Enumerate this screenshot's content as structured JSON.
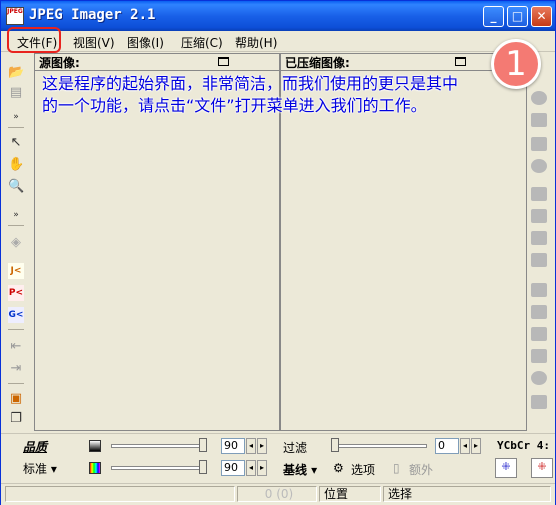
{
  "window": {
    "title": "JPEG Imager 2.1",
    "icon_label": "JPEG",
    "minimize_glyph": "_",
    "maximize_glyph": "□",
    "close_glyph": "✕"
  },
  "menu": [
    "文件(F)",
    "视图(V)",
    "图像(I)",
    "压缩(C)",
    "帮助(H)"
  ],
  "panels": {
    "source_title": "源图像:",
    "compressed_title": "已压缩图像:"
  },
  "instruction": "这是程序的起始界面，非常简洁，而我们使用的更只是其中的一个功能，请点击“文件”打开菜单进入我们的工作。",
  "step_badge": "1",
  "bottom": {
    "quality_label": "品质",
    "mode_select": "标准 ▾",
    "quality_value_1": "90",
    "quality_value_2": "90",
    "filter_label": "过滤",
    "filter_value": "0",
    "baseline_select": "基线 ▾",
    "options_label": "选项",
    "extra_label": "额外",
    "ycbcr_label": "YCbCr 4:"
  },
  "status": {
    "size": "0 (0)",
    "position": "位置",
    "selection": "选择"
  },
  "colors": {
    "title_blue": "#0A5FF1",
    "instruction_text": "#0000E0",
    "highlight_red": "#E8231E",
    "badge": "#F47A73"
  }
}
